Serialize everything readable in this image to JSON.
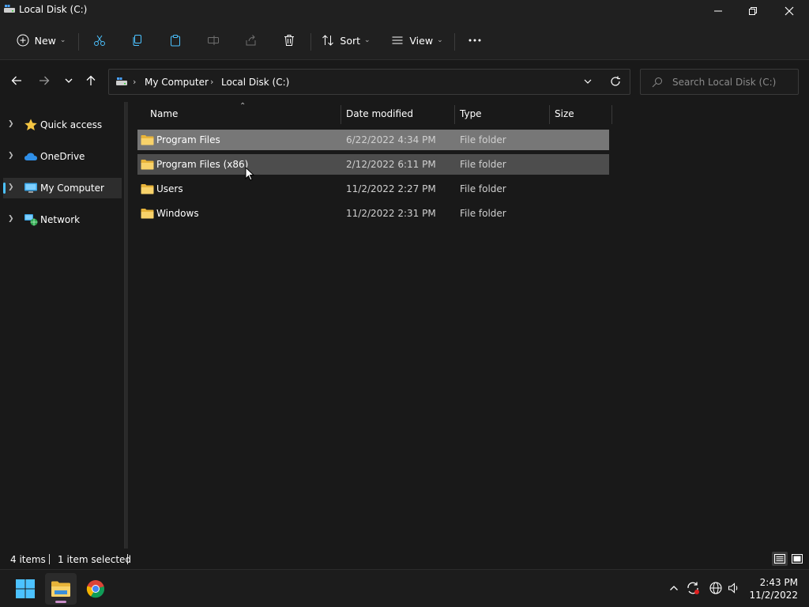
{
  "window": {
    "title": "Local Disk (C:)"
  },
  "commandbar": {
    "new_label": "New",
    "sort_label": "Sort",
    "view_label": "View"
  },
  "address": {
    "crumbs": [
      "My Computer",
      "Local Disk (C:)"
    ],
    "search_placeholder": "Search Local Disk (C:)"
  },
  "navpane": {
    "items": [
      {
        "label": "Quick access",
        "icon": "star-icon"
      },
      {
        "label": "OneDrive",
        "icon": "cloud-icon"
      },
      {
        "label": "My Computer",
        "icon": "computer-icon",
        "active": true
      },
      {
        "label": "Network",
        "icon": "network-icon"
      }
    ]
  },
  "columns": {
    "name": "Name",
    "date": "Date modified",
    "type": "Type",
    "size": "Size"
  },
  "files": [
    {
      "name": "Program Files",
      "date": "6/22/2022 4:34 PM",
      "type": "File folder",
      "size": "",
      "state": "selected"
    },
    {
      "name": "Program Files (x86)",
      "date": "2/12/2022 6:11 PM",
      "type": "File folder",
      "size": "",
      "state": "hover"
    },
    {
      "name": "Users",
      "date": "11/2/2022 2:27 PM",
      "type": "File folder",
      "size": "",
      "state": ""
    },
    {
      "name": "Windows",
      "date": "11/2/2022 2:31 PM",
      "type": "File folder",
      "size": "",
      "state": ""
    }
  ],
  "status": {
    "item_count": "4 items",
    "selection": "1 item selected"
  },
  "taskbar": {
    "time": "2:43 PM",
    "date": "11/2/2022"
  },
  "colors": {
    "accent": "#4cc2ff",
    "folder": "#f4c542",
    "selected_row": "#777777",
    "hover_row": "#4d4d4d"
  }
}
